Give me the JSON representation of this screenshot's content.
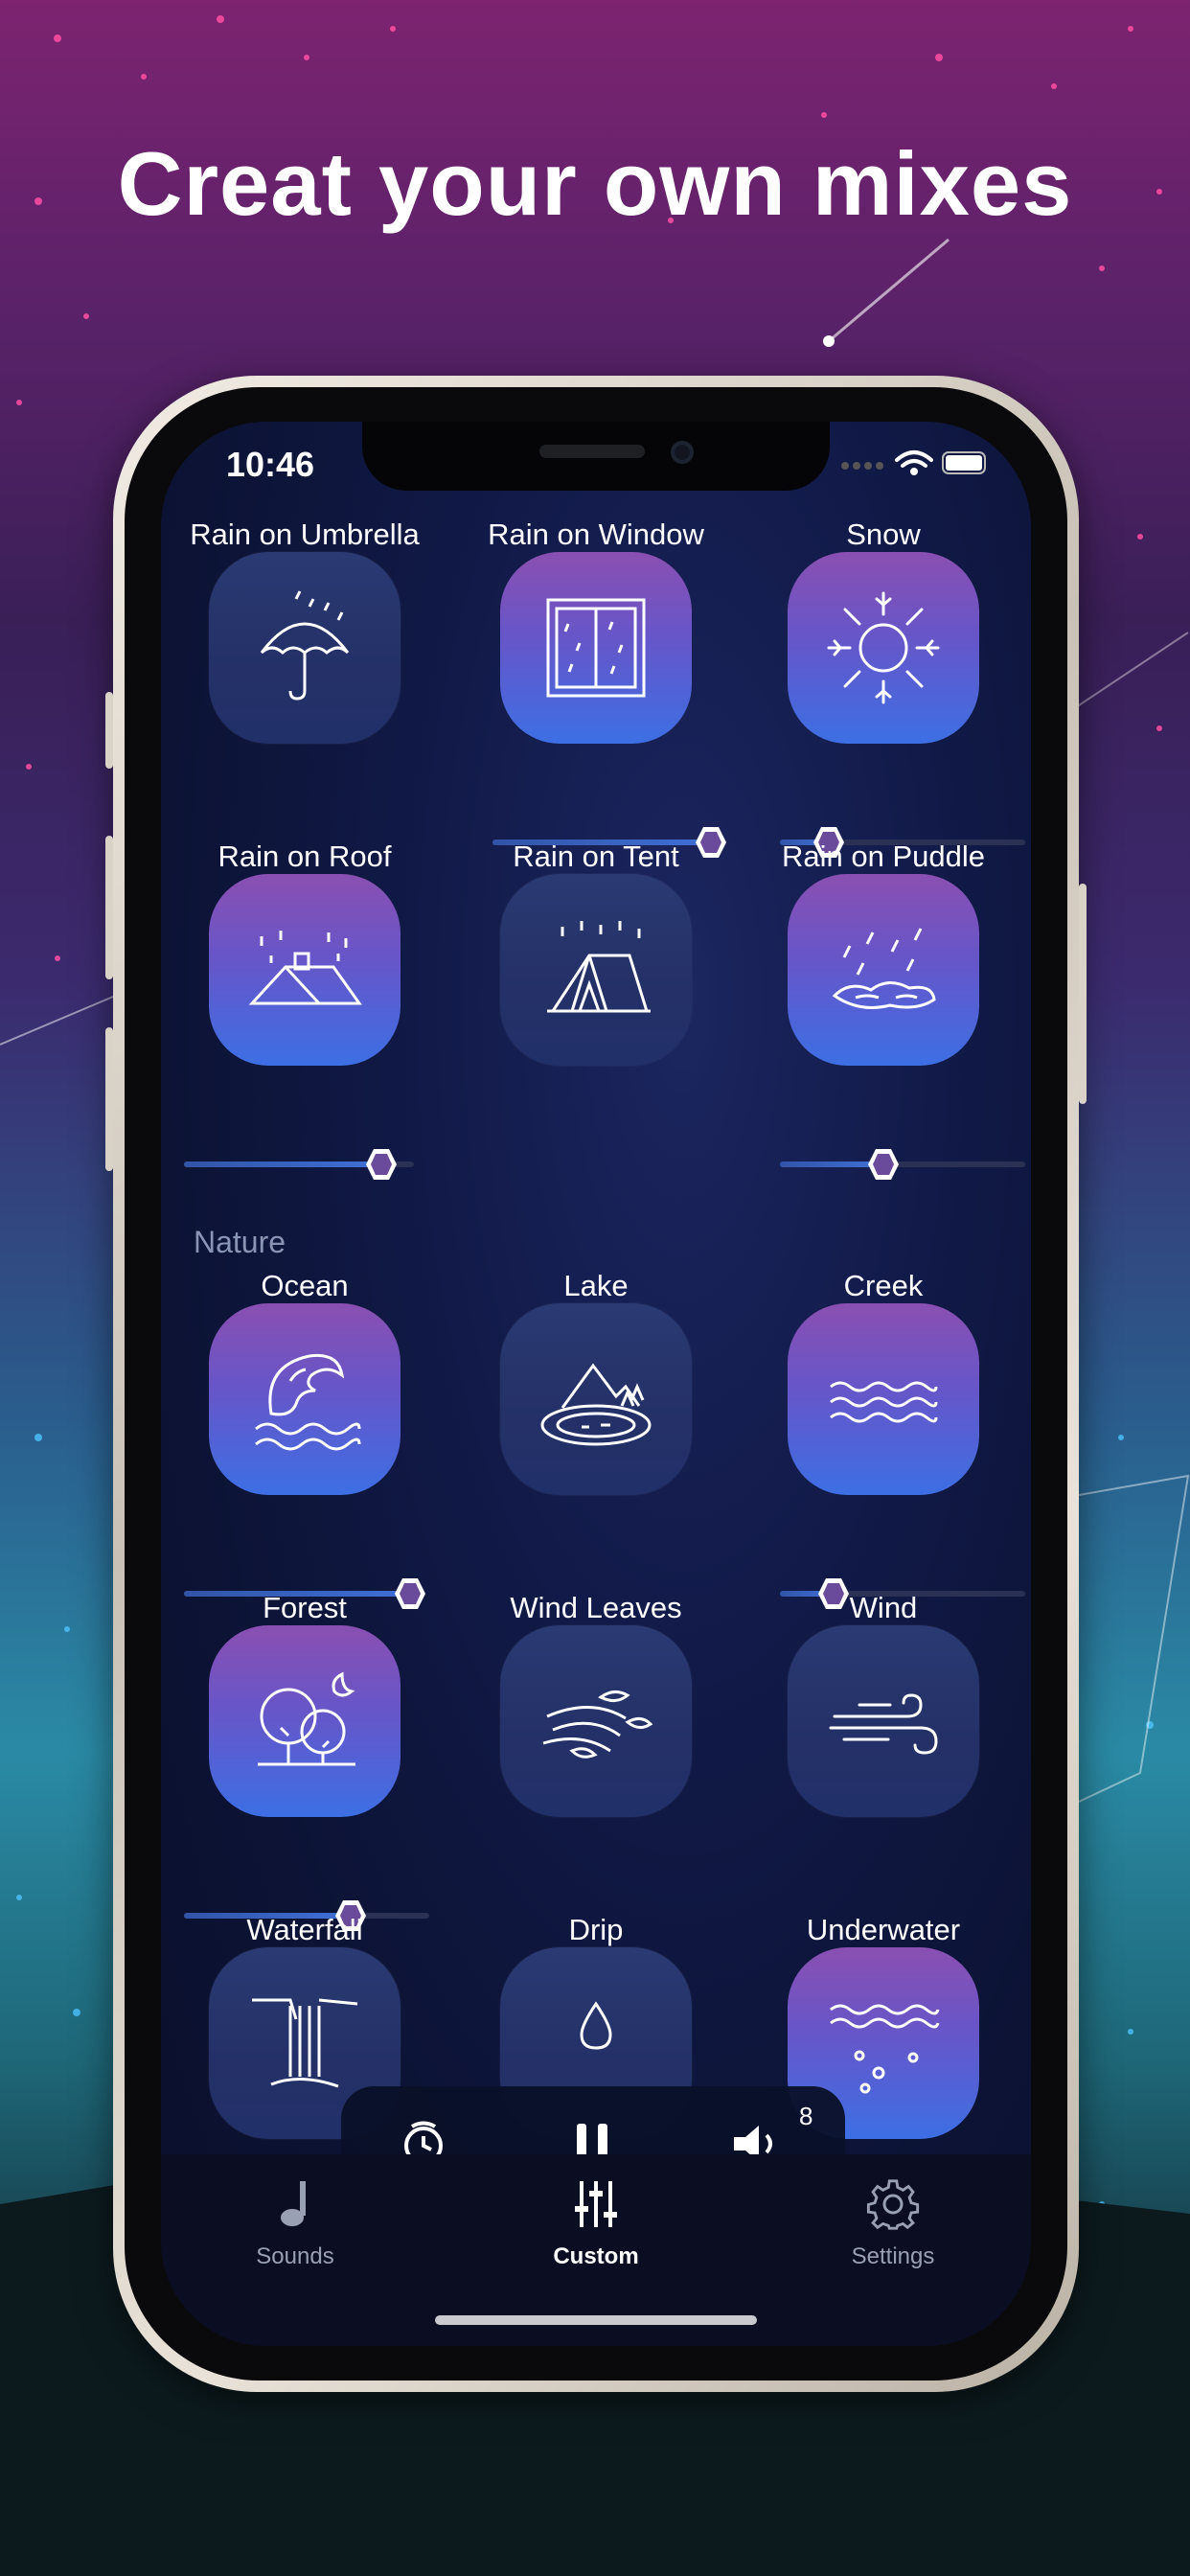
{
  "headline": "Creat your own mixes",
  "status": {
    "time": "10:46"
  },
  "sections": {
    "nature": "Nature"
  },
  "tiles": {
    "rain_umbrella": "Rain on Umbrella",
    "rain_window": "Rain on Window",
    "snow": "Snow",
    "rain_roof": "Rain on Roof",
    "rain_tent": "Rain on Tent",
    "rain_puddle": "Rain on Puddle",
    "ocean": "Ocean",
    "lake": "Lake",
    "creek": "Creek",
    "forest": "Forest",
    "wind_leaves": "Wind Leaves",
    "wind": "Wind",
    "waterfall": "Waterfall",
    "drip": "Drip",
    "underwater": "Underwater"
  },
  "slider_levels": {
    "rain_window": 0.95,
    "snow": 0.2,
    "rain_roof": 0.86,
    "rain_puddle": 0.42,
    "ocean": 0.95,
    "creek": 0.22,
    "forest": 0.68
  },
  "player": {
    "volume_count": "8"
  },
  "tabbar": {
    "sounds": "Sounds",
    "custom": "Custom",
    "settings": "Settings"
  },
  "colors": {
    "accent": "#3f6fd6",
    "knob": "#6a4a9a",
    "active_tile_top": "#8a4fb1",
    "active_tile_bottom": "#3d6fe4"
  }
}
